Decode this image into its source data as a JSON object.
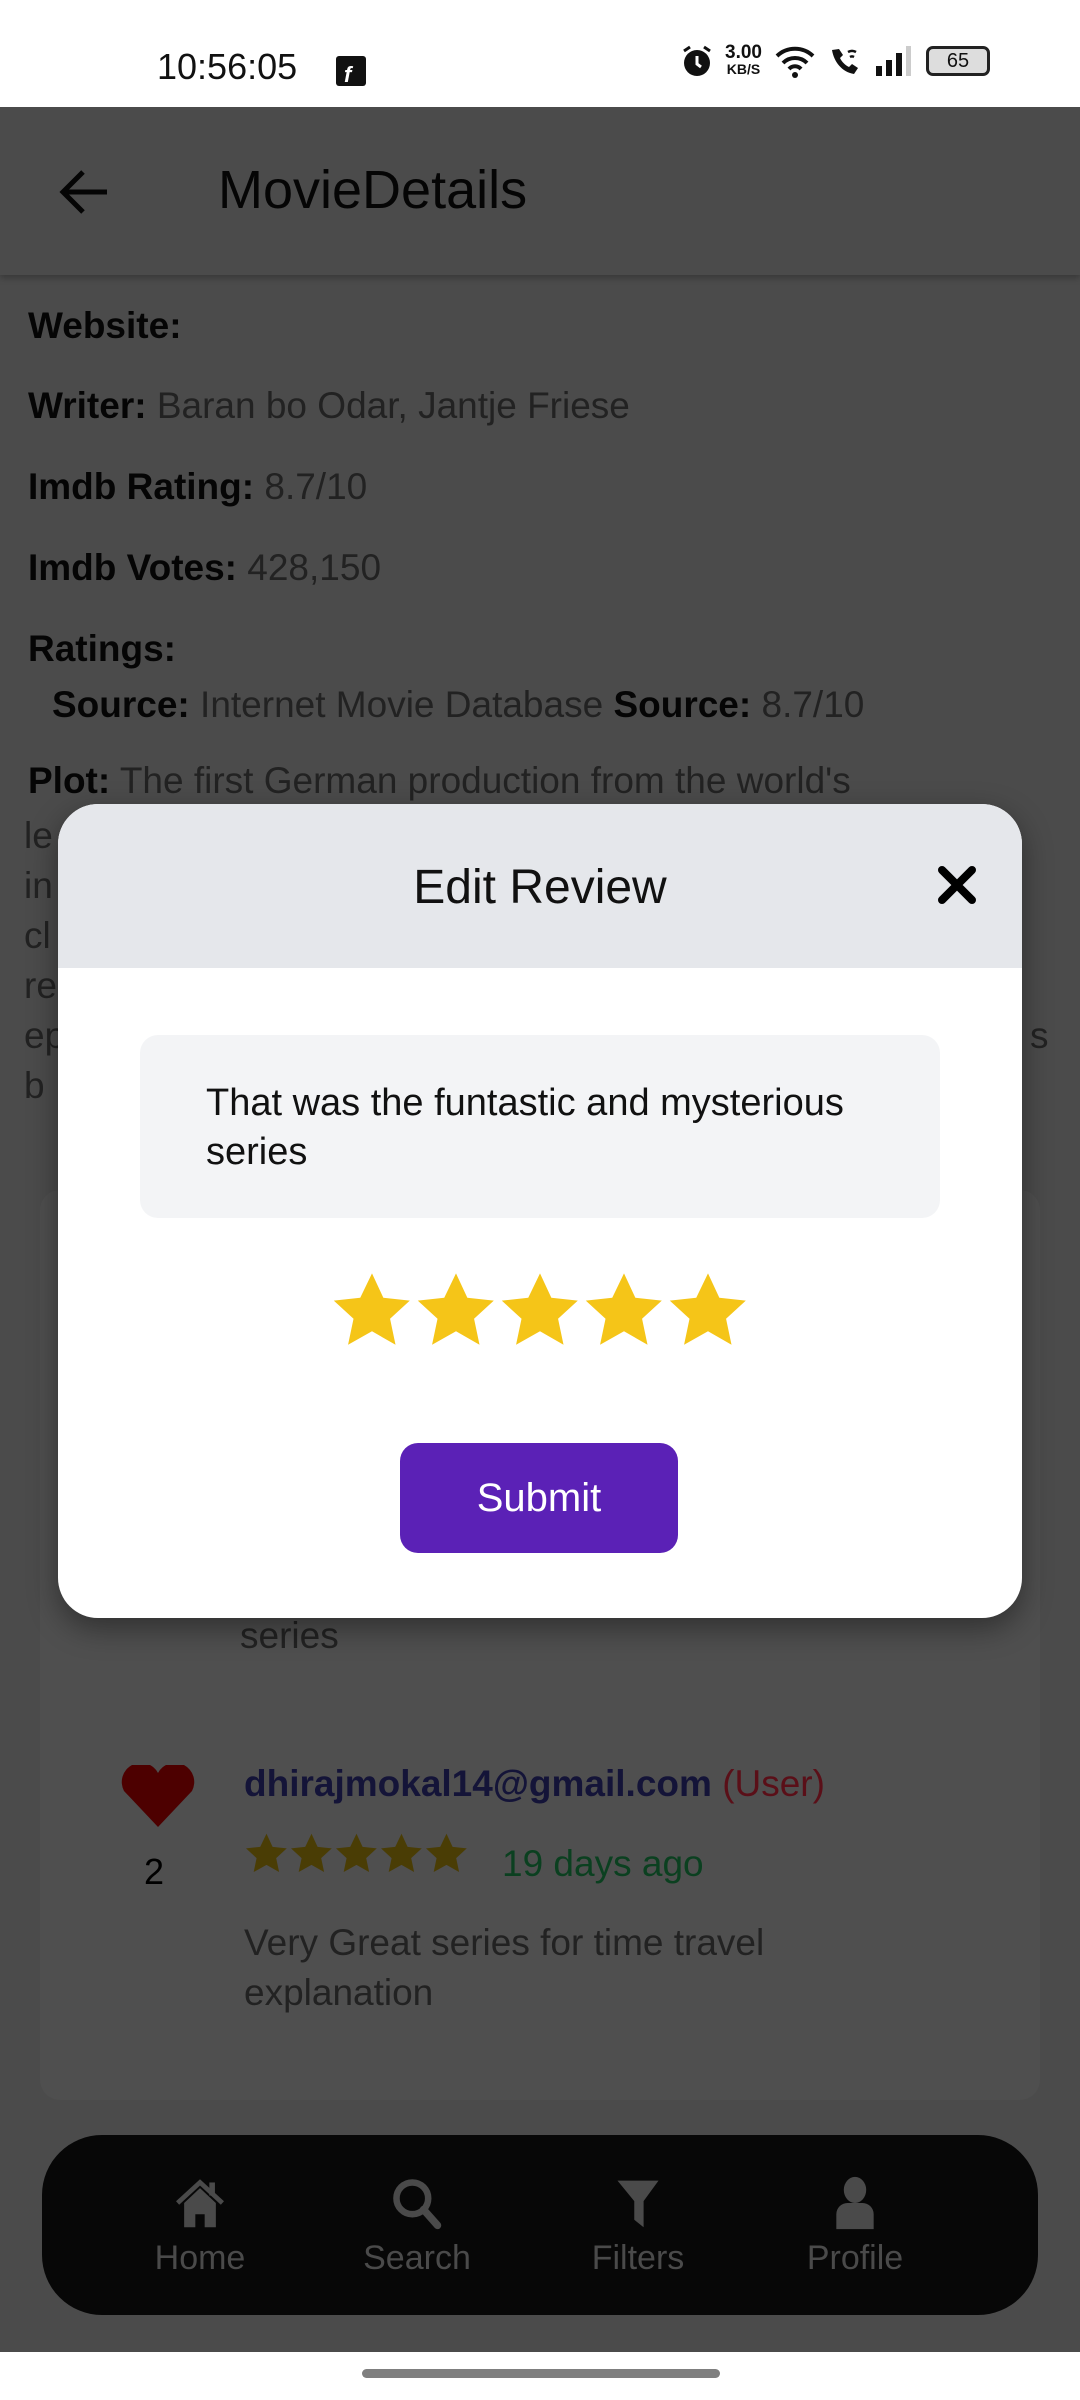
{
  "status_bar": {
    "time": "10:56:05",
    "net_speed": "3.00",
    "net_unit": "KB/S",
    "battery": "65"
  },
  "app_bar": {
    "title": "MovieDetails"
  },
  "details": {
    "website_label": "Website:",
    "writer_label": "Writer:",
    "writer": "Baran bo Odar, Jantje Friese",
    "imdb_rating_label": "Imdb Rating:",
    "imdb_rating": "8.7/10",
    "imdb_votes_label": "Imdb Votes:",
    "imdb_votes": "428,150",
    "ratings_label": "Ratings:",
    "source_label": "Source:",
    "source": "Internet Movie Database",
    "source_label2": "Source:",
    "source_value": "8.7/10",
    "plot_label": "Plot:",
    "plot_first_line": "The first German production from the world's",
    "plot_fragments": [
      "le",
      "in",
      "cl",
      "re",
      "ep",
      "b"
    ],
    "plot_fragment_right": "s"
  },
  "reviews": [
    {
      "text_tail": "series"
    },
    {
      "likes": "2",
      "email": "dhirajmokal14@gmail.com",
      "role": "(User)",
      "rating": 5,
      "time": "19 days ago",
      "text": "Very Great series for time travel explanation"
    }
  ],
  "modal": {
    "title": "Edit Review",
    "review_text": "That was the funtastic and mysterious series",
    "rating": 5,
    "max_rating": 5,
    "submit_label": "Submit",
    "star_color": "#f5c518",
    "button_color": "#5b21b6"
  },
  "bottom_nav": {
    "items": [
      {
        "label": "Home",
        "icon": "home-icon"
      },
      {
        "label": "Search",
        "icon": "search-icon"
      },
      {
        "label": "Filters",
        "icon": "filter-icon"
      },
      {
        "label": "Profile",
        "icon": "profile-icon"
      }
    ]
  }
}
